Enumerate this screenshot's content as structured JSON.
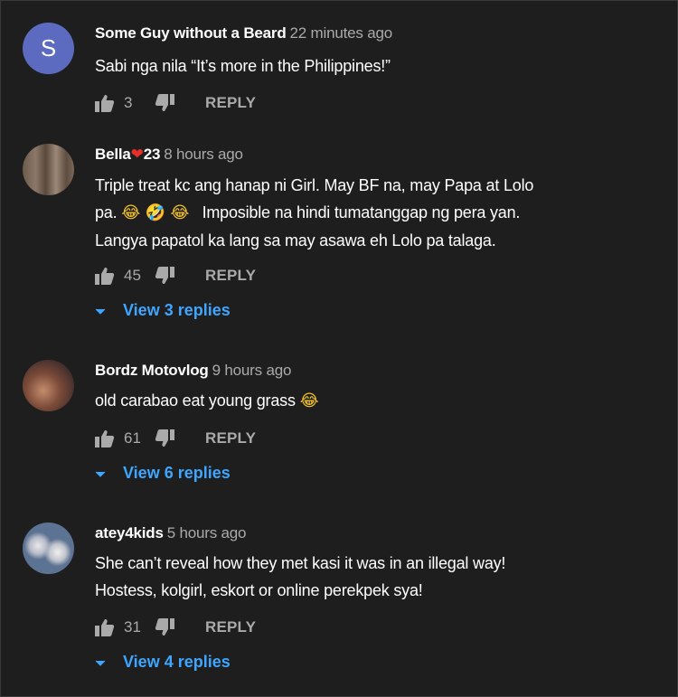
{
  "comments": [
    {
      "author": "Some Guy without a Beard",
      "time": "22 minutes ago",
      "avatar_letter": "S",
      "lines": [
        "Sabi nga nila “It’s more in the Philippines!”"
      ],
      "likes": "3",
      "reply_label": "REPLY"
    },
    {
      "author": "Bella",
      "author_heart": "❤",
      "author_suffix": "23",
      "time": "8 hours ago",
      "lines": [
        "Triple treat kc ang hanap ni Girl. May BF na, may Papa at Lolo",
        "pa.",
        "Imposible na hindi tumatanggap ng pera yan.",
        "Langya papatol ka lang sa may asawa eh Lolo pa talaga."
      ],
      "emojis": "😂 🤣 😂",
      "likes": "45",
      "reply_label": "REPLY",
      "view_replies": "View 3 replies"
    },
    {
      "author": "Bordz Motovlog",
      "time": "9 hours ago",
      "lines": [
        "old carabao eat young grass"
      ],
      "emojis": "😂",
      "likes": "61",
      "reply_label": "REPLY",
      "view_replies": "View 6 replies"
    },
    {
      "author": "atey4kids",
      "time": "5 hours ago",
      "lines": [
        "She can’t reveal how they met kasi it was in an illegal way!",
        "Hostess, kolgirl, eskort or online perekpek sya!"
      ],
      "likes": "31",
      "reply_label": "REPLY",
      "view_replies": "View 4 replies"
    }
  ],
  "colors": {
    "background": "#1e1e1e",
    "link_blue": "#3ea6ff",
    "muted": "#aaaaaa",
    "heart": "#e5302a",
    "avatar_s": "#5c6bc0"
  },
  "icons": [
    "thumb-up-icon",
    "thumb-down-icon",
    "chevron-down-icon"
  ]
}
